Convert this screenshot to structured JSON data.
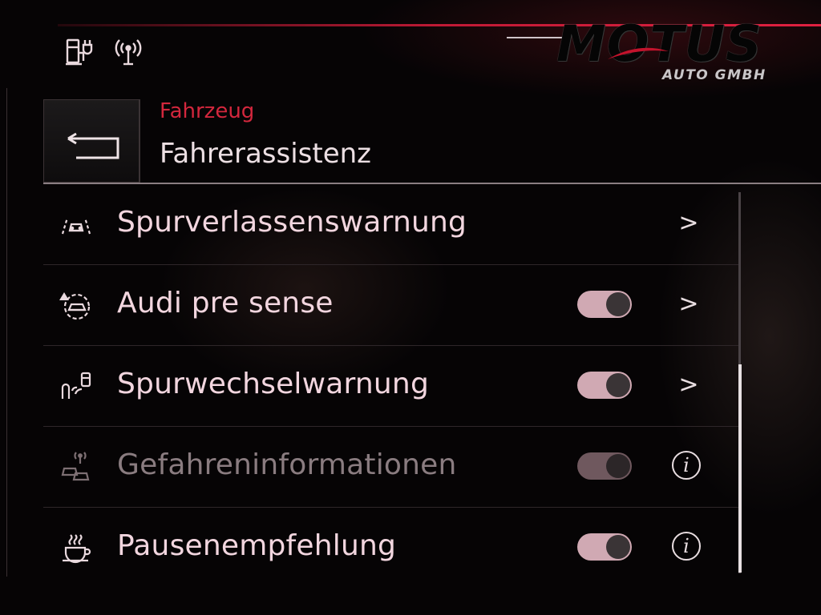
{
  "watermark": {
    "brand": "MOTUS",
    "sub": "AUTO GMBH"
  },
  "status_bar": {
    "icons": [
      "fuel-charge-icon",
      "connectivity-antenna-icon"
    ]
  },
  "header": {
    "breadcrumb": "Fahrzeug",
    "title": "Fahrerassistenz",
    "back_icon": "back-arrow-icon"
  },
  "colors": {
    "accent_red": "#d3273d",
    "label": "#f2d6df",
    "toggle_on": "#d0a9b3",
    "disabled": "#8a7c80"
  },
  "items": [
    {
      "label": "Spurverlassenswarnung",
      "icon": "lane-departure-icon",
      "toggle": null,
      "action": "chevron",
      "action_glyph": ">",
      "enabled": true
    },
    {
      "label": "Audi pre sense",
      "icon": "pre-sense-icon",
      "toggle": "on",
      "action": "chevron",
      "action_glyph": ">",
      "enabled": true
    },
    {
      "label": "Spurwechselwarnung",
      "icon": "lane-change-icon",
      "toggle": "on",
      "action": "chevron",
      "action_glyph": ">",
      "enabled": true
    },
    {
      "label": "Gefahreninformationen",
      "icon": "hazard-info-icon",
      "toggle": "on",
      "action": "info",
      "action_glyph": "i",
      "enabled": false
    },
    {
      "label": "Pausenempfehlung",
      "icon": "coffee-break-icon",
      "toggle": "on",
      "action": "info",
      "action_glyph": "i",
      "enabled": true
    }
  ],
  "scrollbar": {
    "position_fraction": 0.45
  }
}
